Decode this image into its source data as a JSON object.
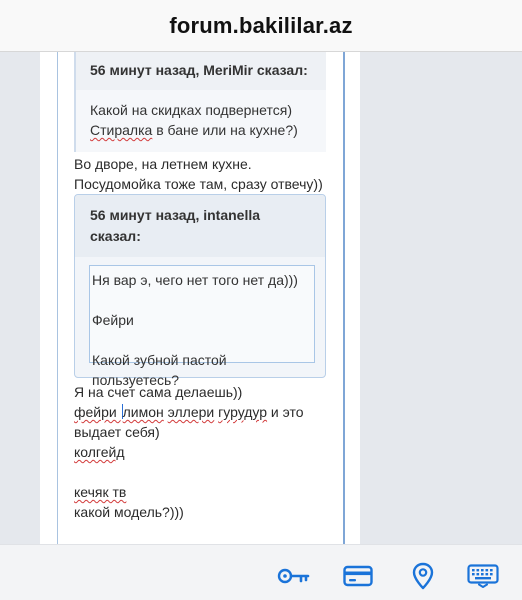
{
  "browser": {
    "domain": "forum.bakililar.az"
  },
  "post": {
    "quote1": {
      "header": "56 минут назад, MeriMir сказал:",
      "line1": "Какой на скидках подвернется)",
      "line2_word1": "Стиралка",
      "line2_rest": " в бане или на кухне?)"
    },
    "reply1_line1": "Во дворе, на летнем кухне.",
    "reply1_line2": "Посудомойка тоже там, сразу отвечу))",
    "quote2": {
      "header_line1": "56 минут назад, intanella",
      "header_line2": "сказал:",
      "line1": "Ня вар э, чего нет того нет да)))",
      "line2": "Фейри",
      "line3": "Какой зубной пастой пользуетесь?"
    },
    "reply2": {
      "line1": "Я на счет сама делаешь))",
      "line2_a": "фейри ",
      "line2_b": "лимон",
      "line2_c": " ",
      "line2_d": "эллери",
      "line2_e": " ",
      "line2_f": "гурудур",
      "line2_g": " и это",
      "line3": "выдает себя)",
      "line4": "колгейд",
      "line5": "кечяк тв",
      "line6": "какой модель?)))"
    }
  },
  "keyboard_toolbar": {
    "icons": [
      "key-icon",
      "credit-card-icon",
      "location-pin-icon",
      "keyboard-icon"
    ],
    "accent_color": "#1a73d9"
  }
}
